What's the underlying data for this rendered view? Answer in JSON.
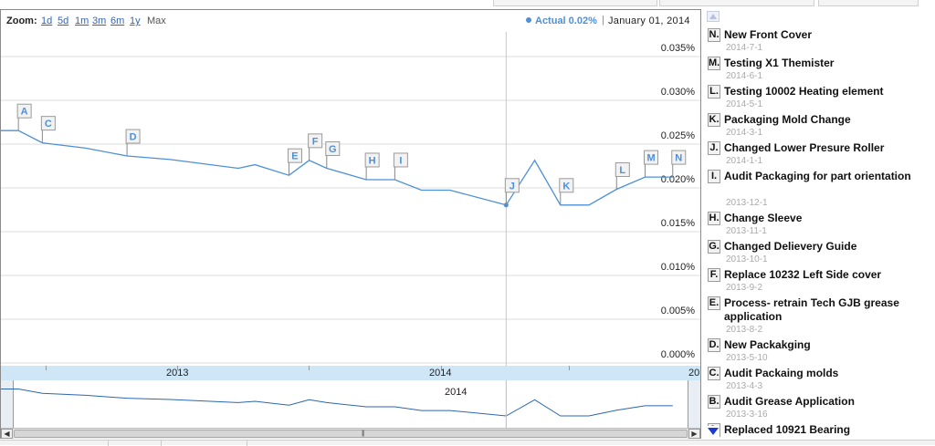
{
  "toolbar": {
    "zoom_label": "Zoom:",
    "zoom_options": [
      "1d",
      "5d",
      "1m",
      "3m",
      "6m",
      "1y"
    ],
    "zoom_max": "Max",
    "legend_series": "Actual 0.02%",
    "legend_separator": "|",
    "legend_date": "January 01, 2014"
  },
  "colors": {
    "series_line": "#4d90d8",
    "axis_band": "#cfe6f7",
    "annotation_marker": "#4d90d8",
    "scroll_down_arrow": "#1a3ccc"
  },
  "chart_data": {
    "type": "line",
    "series": [
      {
        "name": "Actual",
        "points": [
          [
            "2012-07-01",
            0.0255
          ],
          [
            "2012-07-20",
            0.0255
          ],
          [
            "2012-08-15",
            0.0241
          ],
          [
            "2012-10-01",
            0.0235
          ],
          [
            "2012-11-15",
            0.0226
          ],
          [
            "2013-01-01",
            0.0222
          ],
          [
            "2013-03-16",
            0.0212
          ],
          [
            "2013-04-03",
            0.0216
          ],
          [
            "2013-05-10",
            0.0204
          ],
          [
            "2013-06-01",
            0.0221
          ],
          [
            "2013-06-20",
            0.0212
          ],
          [
            "2013-08-02",
            0.0199
          ],
          [
            "2013-09-02",
            0.0199
          ],
          [
            "2013-10-01",
            0.0187
          ],
          [
            "2013-11-01",
            0.0187
          ],
          [
            "2014-01-01",
            0.017
          ],
          [
            "2014-02-01",
            0.0221
          ],
          [
            "2014-03-01",
            0.017
          ],
          [
            "2014-04-01",
            0.017
          ],
          [
            "2014-05-01",
            0.0188
          ],
          [
            "2014-06-01",
            0.0202
          ],
          [
            "2014-07-01",
            0.0202
          ]
        ]
      }
    ],
    "y_ticks": [
      "0.035%",
      "0.030%",
      "0.025%",
      "0.020%",
      "0.015%",
      "0.010%",
      "0.005%",
      "0.000%"
    ],
    "ylim": [
      0,
      0.035
    ],
    "x_ticks": [
      "2013",
      "2014",
      "20"
    ],
    "navigator_label": "2014",
    "grid": true,
    "selected_point": {
      "date": "2014-01-01",
      "value": 0.017
    },
    "flags": [
      {
        "key": "A",
        "date": "2012-07-20",
        "value": 0.0255
      },
      {
        "key": "C",
        "date": "2012-08-15",
        "value": 0.0241
      },
      {
        "key": "D",
        "date": "2012-11-15",
        "value": 0.0226
      },
      {
        "key": "E",
        "date": "2013-05-10",
        "value": 0.0204
      },
      {
        "key": "F",
        "date": "2013-06-01",
        "value": 0.0221
      },
      {
        "key": "G",
        "date": "2013-06-20",
        "value": 0.0212
      },
      {
        "key": "H",
        "date": "2013-08-02",
        "value": 0.0199
      },
      {
        "key": "I",
        "date": "2013-09-02",
        "value": 0.0199
      },
      {
        "key": "J",
        "date": "2014-01-01",
        "value": 0.017
      },
      {
        "key": "K",
        "date": "2014-03-01",
        "value": 0.017
      },
      {
        "key": "L",
        "date": "2014-05-01",
        "value": 0.0188
      },
      {
        "key": "M",
        "date": "2014-06-01",
        "value": 0.0202
      },
      {
        "key": "N",
        "date": "2014-07-01",
        "value": 0.0202
      }
    ]
  },
  "annotations": [
    {
      "key": "N.",
      "title": "New Front Cover",
      "date": "2014-7-1"
    },
    {
      "key": "M.",
      "title": "Testing X1 Themister",
      "date": "2014-6-1"
    },
    {
      "key": "L.",
      "title": "Testing 10002 Heating element",
      "date": "2014-5-1"
    },
    {
      "key": "K.",
      "title": "Packaging Mold Change",
      "date": "2014-3-1"
    },
    {
      "key": "J.",
      "title": "Changed Lower Presure Roller",
      "date": "2014-1-1"
    },
    {
      "key": "I.",
      "title": "Audit Packaging for part orientation",
      "date": "2013-12-1"
    },
    {
      "key": "H.",
      "title": "Change Sleeve",
      "date": "2013-11-1"
    },
    {
      "key": "G.",
      "title": "Changed Delievery Guide",
      "date": "2013-10-1"
    },
    {
      "key": "F.",
      "title": "Replace 10232 Left Side cover",
      "date": "2013-9-2"
    },
    {
      "key": "E.",
      "title": "Process- retrain Tech GJB grease application",
      "date": "2013-8-2"
    },
    {
      "key": "D.",
      "title": "New Packakging",
      "date": "2013-5-10"
    },
    {
      "key": "C.",
      "title": "Audit Packaing molds",
      "date": "2013-4-3"
    },
    {
      "key": "B.",
      "title": "Audit Grease Application",
      "date": "2013-3-16"
    },
    {
      "key": "A.",
      "title": "Replaced 10921 Bearing",
      "date": ""
    }
  ]
}
